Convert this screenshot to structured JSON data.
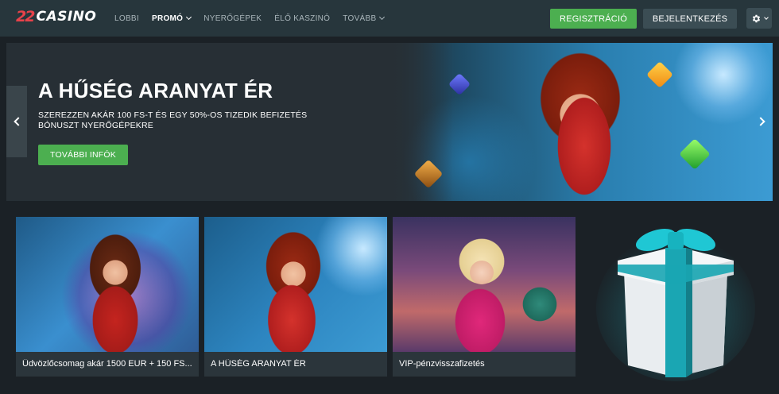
{
  "header": {
    "logo_mark": "22",
    "logo_text": "CASINO",
    "nav": [
      {
        "label": "LOBBI",
        "active": false,
        "dropdown": false
      },
      {
        "label": "PROMÓ",
        "active": true,
        "dropdown": true
      },
      {
        "label": "NYERŐGÉPEK",
        "active": false,
        "dropdown": false
      },
      {
        "label": "ÉLŐ KASZINÓ",
        "active": false,
        "dropdown": false
      },
      {
        "label": "TOVÁBB",
        "active": false,
        "dropdown": true
      }
    ],
    "register_label": "REGISZTRÁCIÓ",
    "login_label": "BEJELENTKEZÉS",
    "settings_icon": "gear-icon"
  },
  "hero": {
    "title": "A HŰSÉG ARANYAT ÉR",
    "subtitle": "SZEREZZEN AKÁR 100 FS-T ÉS EGY 50%-OS TIZEDIK BEFIZETÉS BÓNUSZT NYERŐGÉPEKRE",
    "button_label": "TOVÁBBI INFÓK"
  },
  "promos": [
    {
      "label": "Üdvözlőcsomag akár 1500 EUR + 150 FS..."
    },
    {
      "label": "A HŰSÉG ARANYAT ÉR"
    },
    {
      "label": "VIP-pénzvisszafizetés"
    }
  ],
  "colors": {
    "accent_green": "#4caf50",
    "header_bg": "#27363c",
    "page_bg": "#1b2126",
    "logo_red": "#e8424a",
    "gift_teal": "#1fc7d4"
  }
}
